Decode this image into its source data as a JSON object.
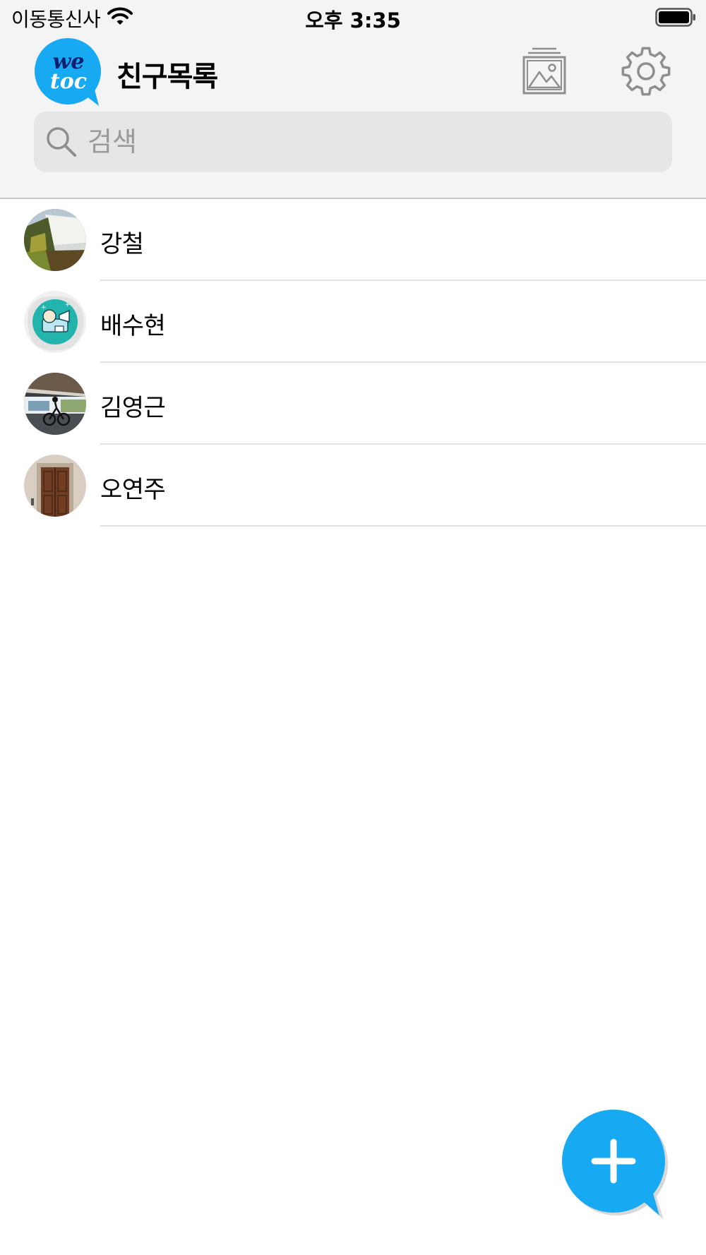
{
  "status_bar": {
    "carrier": "이동통신사",
    "time": "오후 3:35"
  },
  "header": {
    "logo_text_top": "we",
    "logo_text_bottom": "toc",
    "title": "친구목록"
  },
  "search": {
    "placeholder": "검색",
    "value": ""
  },
  "friends": [
    {
      "name": "강철",
      "avatar": "waterfall-photo"
    },
    {
      "name": "배수현",
      "avatar": "announcer-illustration"
    },
    {
      "name": "김영근",
      "avatar": "cyclist-photo"
    },
    {
      "name": "오연주",
      "avatar": "wooden-door-photo"
    }
  ],
  "icons": {
    "search": "search-icon",
    "gallery": "gallery-icon",
    "settings": "gear-icon",
    "add": "plus-icon",
    "wifi": "wifi-icon",
    "battery": "battery-icon"
  },
  "colors": {
    "brand_blue": "#17a9f1",
    "header_bg": "#f5f4f4",
    "search_bg": "#e6e6e6",
    "icon_gray": "#8e8e8e"
  }
}
